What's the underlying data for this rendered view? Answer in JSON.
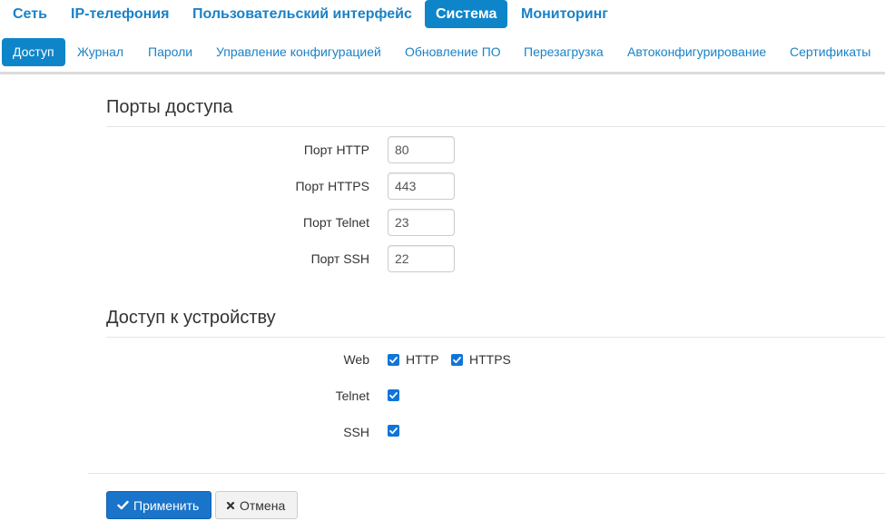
{
  "top_nav": {
    "items": [
      {
        "label": "Сеть"
      },
      {
        "label": "IP-телефония"
      },
      {
        "label": "Пользовательский интерфейс"
      },
      {
        "label": "Система"
      },
      {
        "label": "Мониторинг"
      }
    ],
    "active": "Система"
  },
  "sub_nav": {
    "items": [
      {
        "label": "Доступ"
      },
      {
        "label": "Журнал"
      },
      {
        "label": "Пароли"
      },
      {
        "label": "Управление конфигурацией"
      },
      {
        "label": "Обновление ПО"
      },
      {
        "label": "Перезагрузка"
      },
      {
        "label": "Автоконфигурирование"
      },
      {
        "label": "Сертификаты"
      }
    ],
    "active": "Доступ"
  },
  "ports": {
    "title": "Порты доступа",
    "http": {
      "label": "Порт HTTP",
      "value": "80"
    },
    "https": {
      "label": "Порт HTTPS",
      "value": "443"
    },
    "telnet": {
      "label": "Порт Telnet",
      "value": "23"
    },
    "ssh": {
      "label": "Порт SSH",
      "value": "22"
    }
  },
  "device_access": {
    "title": "Доступ к устройству",
    "web": {
      "label": "Web",
      "http_label": "HTTP",
      "http_checked": true,
      "https_label": "HTTPS",
      "https_checked": true
    },
    "telnet": {
      "label": "Telnet",
      "checked": true
    },
    "ssh": {
      "label": "SSH",
      "checked": true
    }
  },
  "buttons": {
    "apply": "Применить",
    "cancel": "Отмена"
  },
  "colors": {
    "accent": "#0f85c9",
    "link": "#1a82c7",
    "checkbox": "#0f75d9"
  }
}
